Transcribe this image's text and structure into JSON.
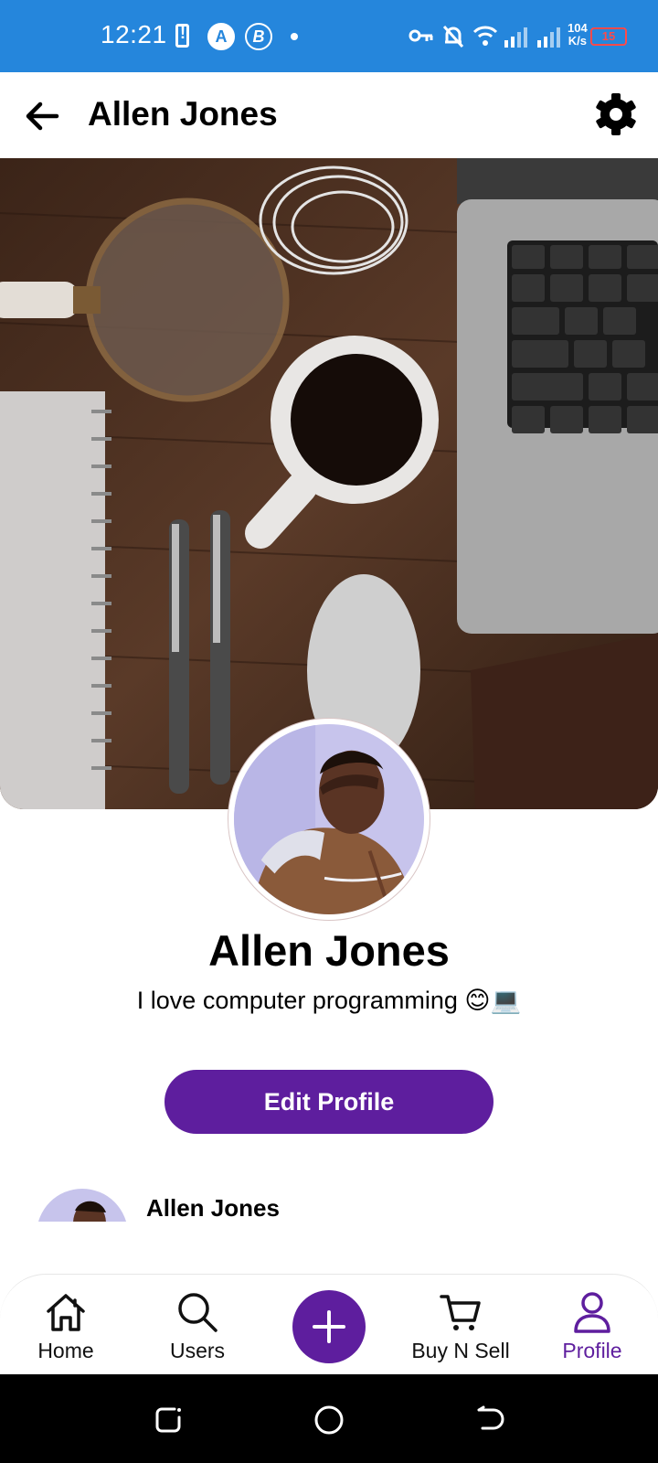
{
  "status_bar": {
    "time": "12:21",
    "network_speed_value": "104",
    "network_speed_unit": "K/s",
    "battery": "15"
  },
  "app_bar": {
    "title": "Allen Jones"
  },
  "profile": {
    "name": "Allen Jones",
    "bio": "I love computer programming 😊💻",
    "edit_button": "Edit Profile"
  },
  "post": {
    "author": "Allen Jones"
  },
  "bottom_nav": {
    "items": [
      {
        "label": "Home",
        "icon": "home-icon"
      },
      {
        "label": "Users",
        "icon": "search-icon"
      },
      {
        "label": "",
        "icon": "plus-icon"
      },
      {
        "label": "Buy N Sell",
        "icon": "cart-icon"
      },
      {
        "label": "Profile",
        "icon": "profile-icon"
      }
    ],
    "active": "Profile"
  },
  "colors": {
    "status_bar": "#2586dc",
    "accent": "#5e1e9e"
  }
}
